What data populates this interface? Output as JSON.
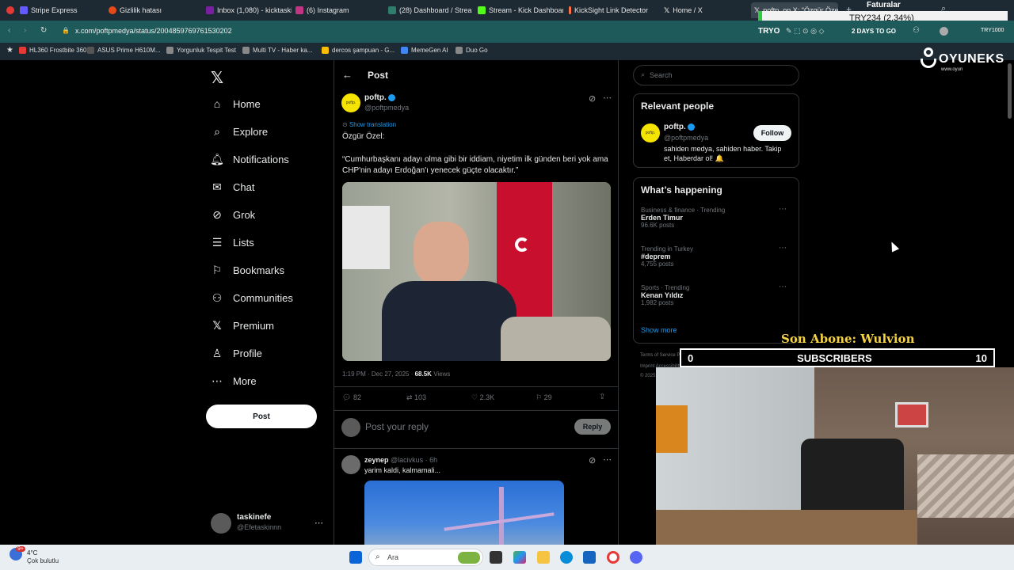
{
  "browser": {
    "tabs": [
      {
        "label": "Stripe Express",
        "color": "#635bff"
      },
      {
        "label": "Gizlilik hatası",
        "color": "#e64a19"
      },
      {
        "label": "Inbox (1,080) - kicktaskin",
        "color": "#7b1fa2"
      },
      {
        "label": "(6) Instagram",
        "color": "#c13584"
      },
      {
        "label": "(28) Dashboard / Streamla",
        "color": "#2e7d6d"
      },
      {
        "label": "Stream - Kick Dashboard",
        "color": "#53fc18"
      },
      {
        "label": "KickSight Link Detector",
        "color": "#ff7043"
      },
      {
        "label": "Home / X",
        "color": "#000000"
      },
      {
        "label": "poftp. on X: \"Özgür Özel:",
        "color": "#000000"
      }
    ],
    "url": "x.com/poftpmedya/status/2004859769761530202",
    "bookmarks": [
      {
        "label": "HL360 Frostbite 360...",
        "color": "#e53935"
      },
      {
        "label": "ASUS Prime H610M...",
        "color": "#555555"
      },
      {
        "label": "Yorgunluk Tespit Test",
        "color": "#888888"
      },
      {
        "label": "Multi TV - Haber ka...",
        "color": "#888888"
      },
      {
        "label": "dercos şampuan - G...",
        "color": "#fbbc05"
      },
      {
        "label": "MemeGen AI",
        "color": "#4285f4"
      },
      {
        "label": "Duo Go",
        "color": "#888888"
      }
    ],
    "ext_text": "TRYO",
    "days_text": "2 DAYS TO GO",
    "try_small": "TRY1000"
  },
  "overlay": {
    "faturalar": "Faturalar",
    "ticker": "TRY234 (2.34%)",
    "brand": "OYUNEKS",
    "brand_sub": "www.oyun",
    "son_abone": "Son Abone: Wulvion",
    "subs_left": "0",
    "subs_label": "SUBSCRIBERS",
    "subs_right": "10"
  },
  "nav": {
    "items": [
      {
        "label": "Home",
        "icon": "home-icon"
      },
      {
        "label": "Explore",
        "icon": "search-icon"
      },
      {
        "label": "Notifications",
        "icon": "bell-icon"
      },
      {
        "label": "Chat",
        "icon": "mail-icon"
      },
      {
        "label": "Grok",
        "icon": "grok-icon"
      },
      {
        "label": "Lists",
        "icon": "list-icon"
      },
      {
        "label": "Bookmarks",
        "icon": "bookmark-icon"
      },
      {
        "label": "Communities",
        "icon": "people-icon"
      },
      {
        "label": "Premium",
        "icon": "x-icon"
      },
      {
        "label": "Profile",
        "icon": "user-icon"
      },
      {
        "label": "More",
        "icon": "more-icon"
      }
    ],
    "post_label": "Post",
    "account": {
      "name": "taskinefe",
      "handle": "@Efetaskinnn"
    }
  },
  "post": {
    "header": "Post",
    "author": "poftp.",
    "handle": "@poftpmedya",
    "show_translation": "Show translation",
    "line1": "Özgür Özel:",
    "quote": "“Cumhurbaşkanı adayı olma gibi bir iddiam, niyetim ilk günden beri yok ama CHP'nin adayı Erdoğan'ı yenecek güçte olacaktır.”",
    "time": "1:19 PM · Dec 27, 2025 · ",
    "views_count": "68.5K",
    "views_label": " Views",
    "replies": "82",
    "reposts": "103",
    "likes": "2.3K",
    "bookmarks": "29",
    "reply_placeholder": "Post your reply",
    "reply_button": "Reply"
  },
  "reply": {
    "author": "zeynep",
    "handle": "@lacivkus · 6h",
    "text": "yarim kaldi, kalmamali..."
  },
  "sidebar": {
    "search_placeholder": "Search",
    "relevant_title": "Relevant people",
    "person_name": "poftp.",
    "person_handle": "@poftpmedya",
    "person_bio": "sahiden medya, sahiden haber. Takip et, Haberdar ol! 🔔",
    "follow_label": "Follow",
    "happening_title": "What’s happening",
    "trends": [
      {
        "category": "Business & finance · Trending",
        "name": "Erden Timur",
        "count": "96.6K posts"
      },
      {
        "category": "Trending in Turkey",
        "name": "#deprem",
        "count": "4,755 posts"
      },
      {
        "category": "Sports · Trending",
        "name": "Kenan Yıldız",
        "count": "1,982 posts"
      }
    ],
    "show_more": "Show more",
    "footer1": "Terms of Service   Privacy Policy   Cookie Policy",
    "footer2": "Imprint   Accessibility   Ads info",
    "footer3": "© 2025"
  },
  "taskbar": {
    "temp": "4°C",
    "weather": "Çok bulutlu",
    "search_placeholder": "Ara",
    "badge": "9+"
  }
}
